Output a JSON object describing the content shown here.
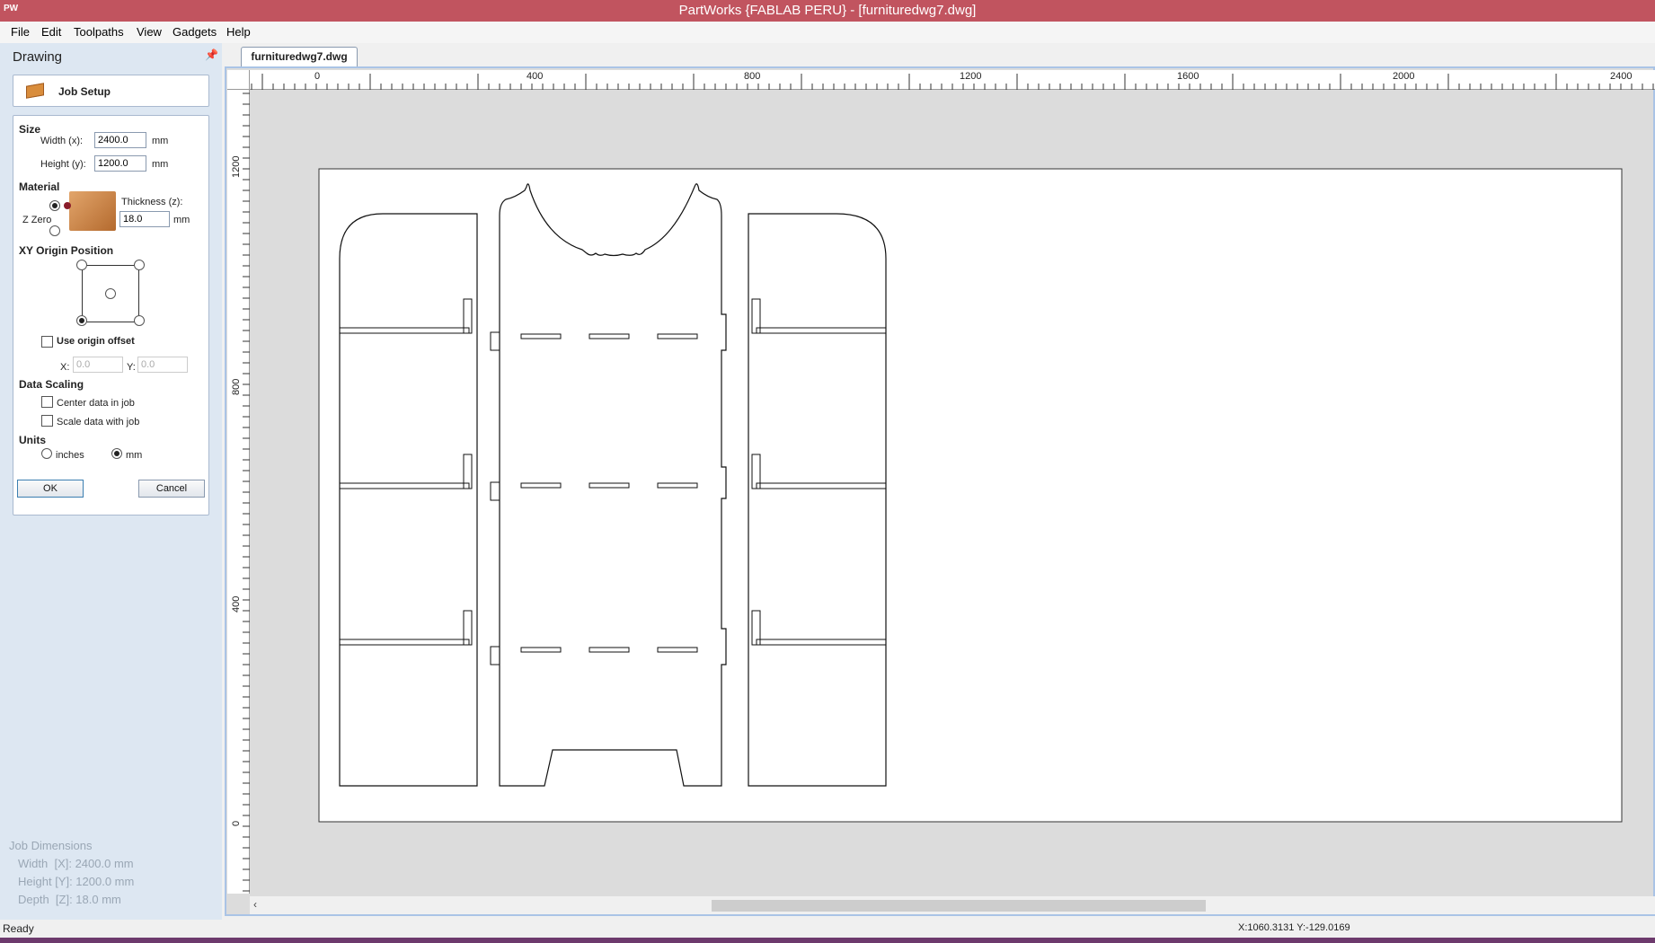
{
  "window": {
    "title": "PartWorks {FABLAB PERU} - [furnituredwg7.dwg]",
    "app_icon": "PW"
  },
  "menu": [
    "File",
    "Edit",
    "Toolpaths",
    "View",
    "Gadgets",
    "Help"
  ],
  "panel": {
    "title": "Drawing",
    "pin_icon": "pin-icon",
    "job_setup": {
      "heading": "Job Setup"
    },
    "size": {
      "section": "Size",
      "width_label": "Width (x):",
      "width_value": "2400.0",
      "width_unit": "mm",
      "height_label": "Height (y):",
      "height_value": "1200.0",
      "height_unit": "mm"
    },
    "material": {
      "section": "Material",
      "z_zero_label": "Z Zero",
      "thickness_label": "Thickness (z):",
      "thickness_value": "18.0",
      "thickness_unit": "mm"
    },
    "xy_origin": {
      "section": "XY Origin Position",
      "selected": "bottom-left"
    },
    "origin_offset": {
      "label": "Use origin offset",
      "checked": false,
      "x_label": "X:",
      "x_value": "0.0",
      "y_label": "Y:",
      "y_value": "0.0"
    },
    "data_scaling": {
      "section": "Data Scaling",
      "center_label": "Center data in job",
      "center_checked": false,
      "scale_label": "Scale data with job",
      "scale_checked": false
    },
    "units": {
      "section": "Units",
      "inches_label": "inches",
      "mm_label": "mm",
      "selected": "mm"
    },
    "ok_label": "OK",
    "cancel_label": "Cancel",
    "job_dimensions": {
      "heading": "Job Dimensions",
      "width": "Width  [X]: 2400.0 mm",
      "height": "Height [Y]: 1200.0 mm",
      "depth": "Depth  [Z]: 18.0 mm"
    }
  },
  "document_tab": "furnituredwg7.dwg",
  "rulers": {
    "horizontal": [
      "0",
      "400",
      "800",
      "1200",
      "1600",
      "2000",
      "2400"
    ],
    "vertical": [
      "1200",
      "800",
      "400",
      "0"
    ]
  },
  "status": {
    "ready": "Ready",
    "coords": "X:1060.3131 Y:-129.0169"
  }
}
